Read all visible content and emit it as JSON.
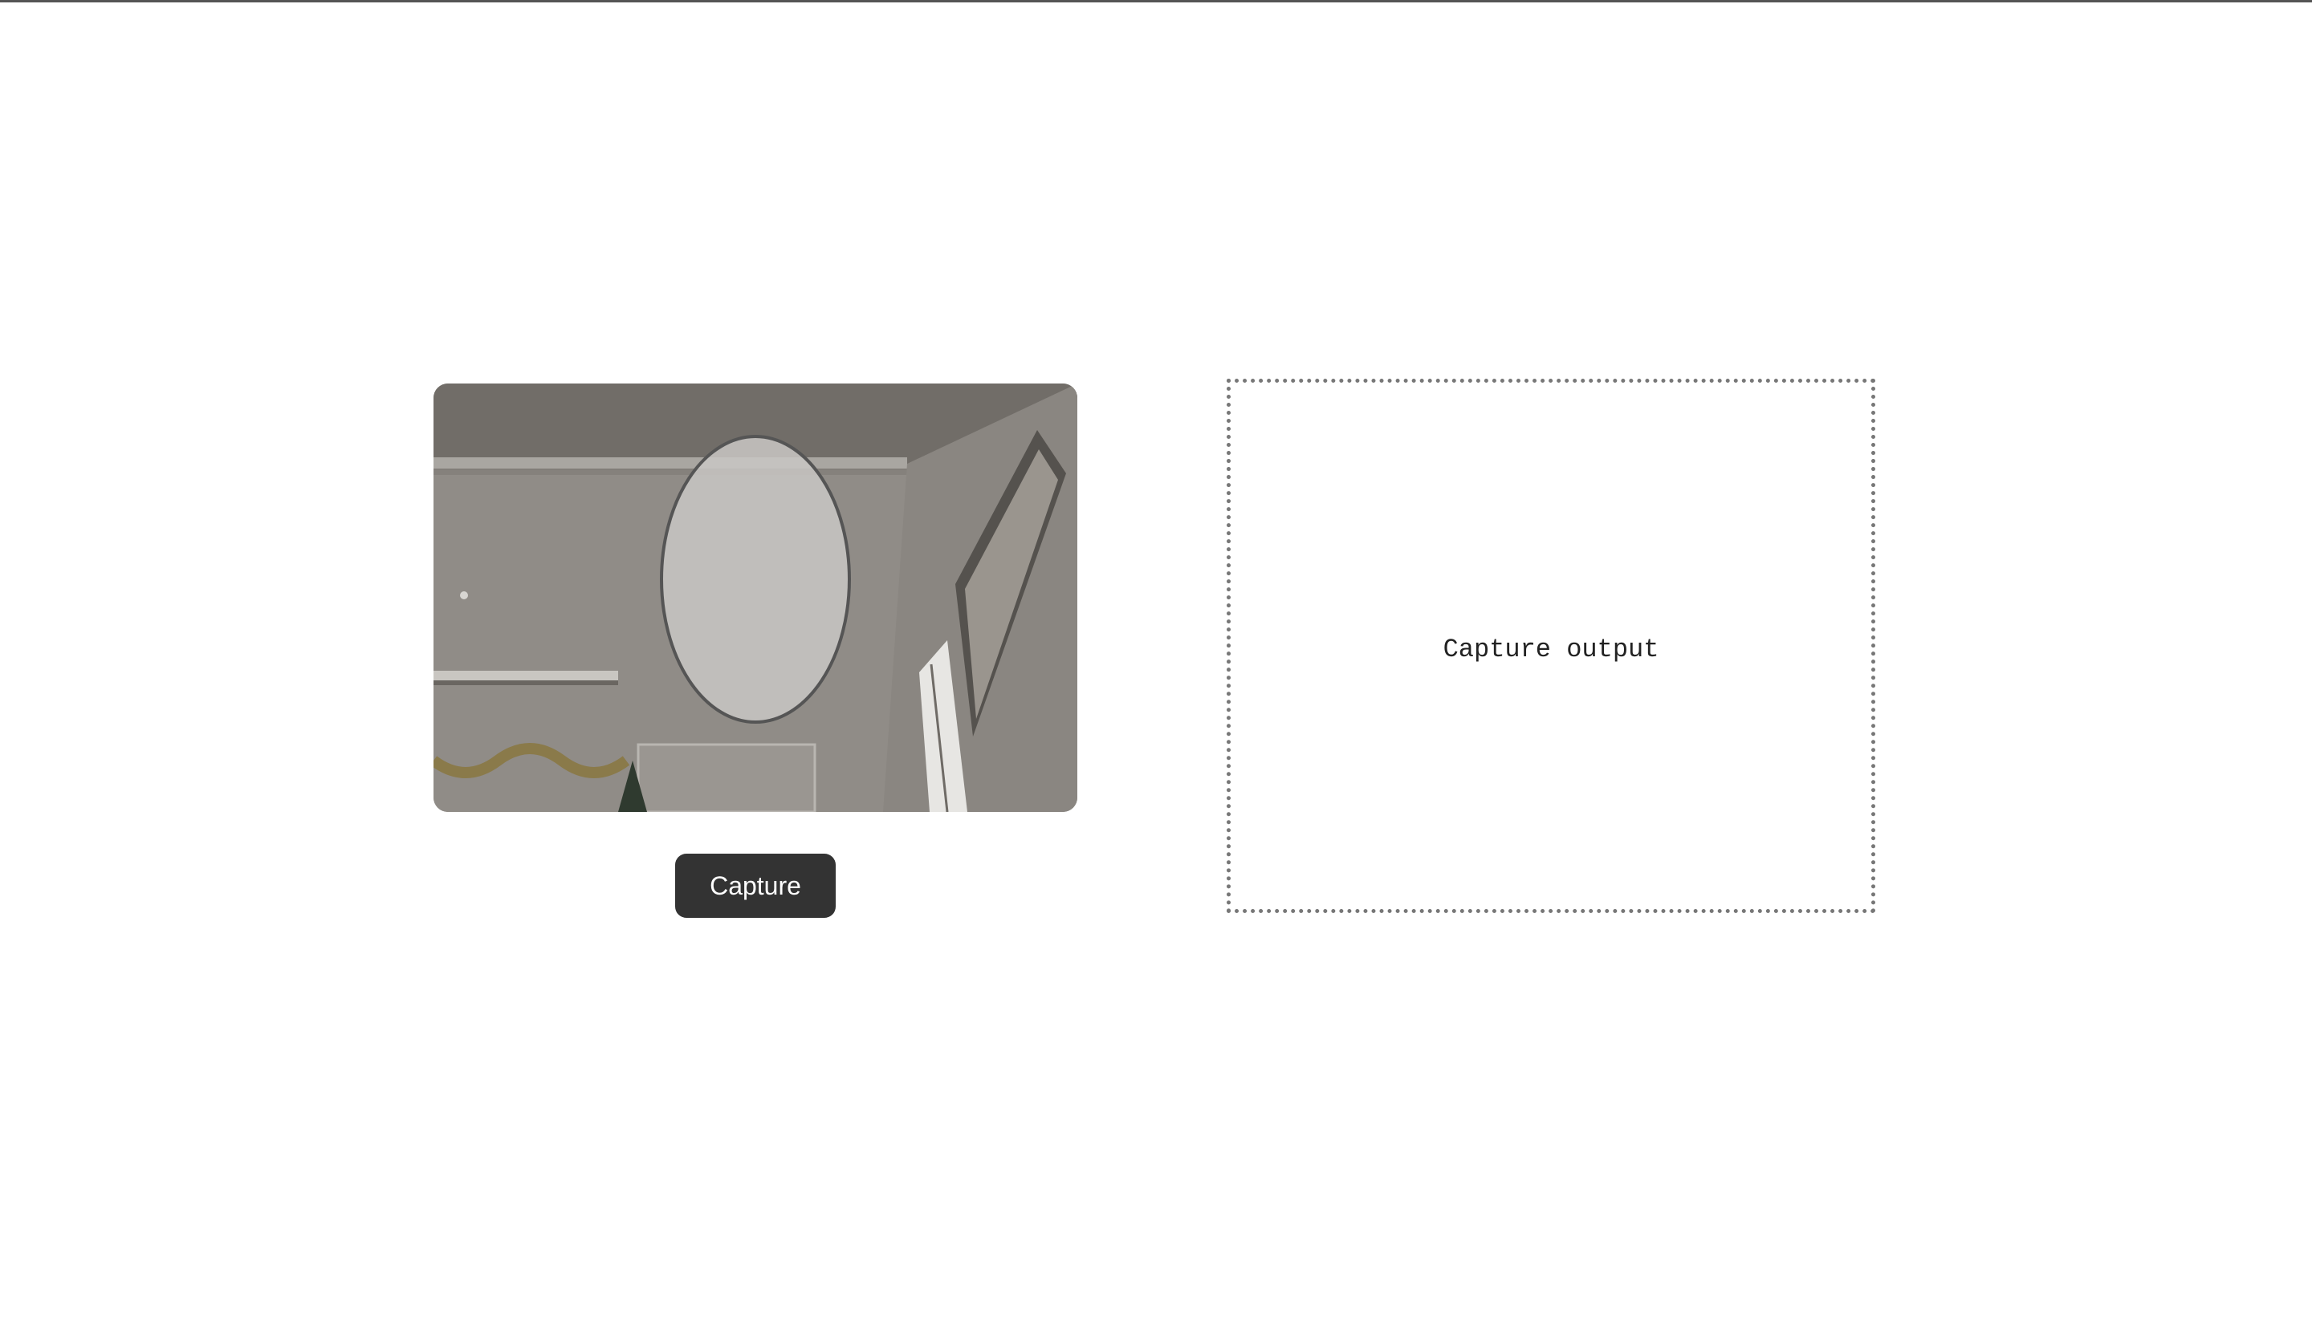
{
  "camera": {
    "overlay_shape": "oval-face-guide",
    "overlay_color": "#555555"
  },
  "capture_button": {
    "label": "Capture",
    "background": "#333333",
    "text_color": "#ffffff"
  },
  "output": {
    "placeholder": "Capture output",
    "border_color": "#777777"
  },
  "colors": {
    "page_background": "#ffffff",
    "top_rule": "#555555"
  }
}
